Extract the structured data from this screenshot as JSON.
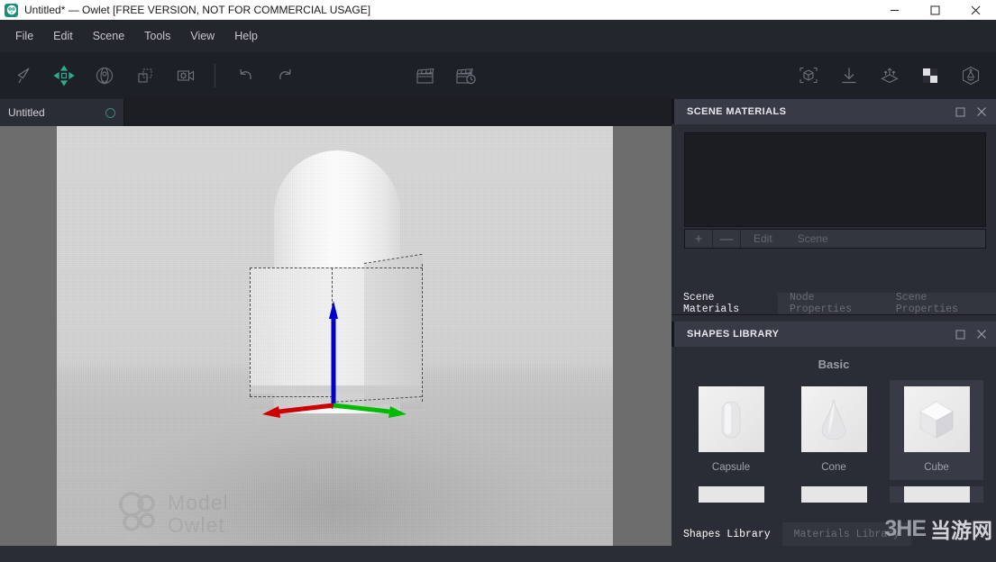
{
  "window": {
    "title": "Untitled* — Owlet [FREE VERSION, NOT FOR COMMERCIAL USAGE]",
    "app_icon": "owl-app-icon",
    "controls": {
      "minimize": "minimize-icon",
      "maximize": "maximize-icon",
      "close": "close-icon"
    }
  },
  "menubar": {
    "items": [
      {
        "label": "File"
      },
      {
        "label": "Edit"
      },
      {
        "label": "Scene"
      },
      {
        "label": "Tools"
      },
      {
        "label": "View"
      },
      {
        "label": "Help"
      }
    ]
  },
  "toolbar": {
    "left_group": [
      {
        "name": "select-tool",
        "icon": "cursor-arrow-icon",
        "active": false
      },
      {
        "name": "move-tool",
        "icon": "move-arrows-icon",
        "active": true
      },
      {
        "name": "rotate-tool",
        "icon": "rotate-orbit-icon",
        "active": false
      },
      {
        "name": "scale-tool",
        "icon": "scale-box-icon",
        "active": false
      },
      {
        "name": "camera-settings-tool",
        "icon": "camera-gear-icon",
        "active": false
      }
    ],
    "history_group": [
      {
        "name": "undo-button",
        "icon": "undo-arrow-icon"
      },
      {
        "name": "redo-button",
        "icon": "redo-arrow-icon"
      }
    ],
    "render_group": [
      {
        "name": "render-button",
        "icon": "clapperboard-icon"
      },
      {
        "name": "render-timed-button",
        "icon": "clapperboard-clock-icon"
      }
    ],
    "right_group": [
      {
        "name": "focus-object-button",
        "icon": "focus-cube-icon"
      },
      {
        "name": "drop-to-floor-button",
        "icon": "arrow-down-to-line-icon"
      },
      {
        "name": "scatter-button",
        "icon": "scatter-plane-icon"
      },
      {
        "name": "checker-material-button",
        "icon": "checker-square-icon"
      },
      {
        "name": "environment-button",
        "icon": "hex-environment-icon"
      }
    ]
  },
  "document_tabs": [
    {
      "label": "Untitled",
      "modified_dot": "unsaved-dot",
      "active": true
    }
  ],
  "viewport": {
    "watermark": "Model\nOwlet",
    "objects": [
      {
        "name": "capsule-mesh",
        "selected": false
      },
      {
        "name": "cube-mesh",
        "selected": true
      }
    ],
    "gizmo": {
      "type": "translate-gizmo",
      "axes": [
        {
          "axis": "X",
          "color": "#cc0000"
        },
        {
          "axis": "Y",
          "color": "#0000cc"
        },
        {
          "axis": "Z",
          "color": "#00bb00"
        }
      ]
    }
  },
  "scene_materials_panel": {
    "title": "SCENE MATERIALS",
    "maximize_icon": "maximize-panel-icon",
    "close_icon": "close-panel-icon",
    "list_items": [],
    "list_toolbar": {
      "add_label": "+",
      "remove_label": "—",
      "edit_label": "Edit",
      "scene_label": "Scene"
    },
    "tabs": [
      {
        "label": "Scene Materials",
        "active": true
      },
      {
        "label": "Node Properties",
        "active": false
      },
      {
        "label": "Scene Properties",
        "active": false
      }
    ]
  },
  "shapes_library_panel": {
    "title": "SHAPES LIBRARY",
    "maximize_icon": "maximize-panel-icon",
    "close_icon": "close-panel-icon",
    "section_title": "Basic",
    "shapes": [
      {
        "label": "Capsule",
        "icon": "capsule-thumb",
        "selected": false
      },
      {
        "label": "Cone",
        "icon": "cone-thumb",
        "selected": false
      },
      {
        "label": "Cube",
        "icon": "cube-thumb",
        "selected": true
      }
    ],
    "tabs": [
      {
        "label": "Shapes Library",
        "active": true
      },
      {
        "label": "Materials Library",
        "active": false
      }
    ]
  },
  "watermark": {
    "latin": "3HE",
    "cjk": "当游网"
  },
  "colors": {
    "accent": "#2fa98a",
    "panel_bg": "#2b2d36",
    "panel_header": "#383b46",
    "toolbar_bg": "#1e2027",
    "menubar_bg": "#24262d",
    "axis_x": "#cc0000",
    "axis_y": "#0000cc",
    "axis_z": "#00bb00"
  }
}
